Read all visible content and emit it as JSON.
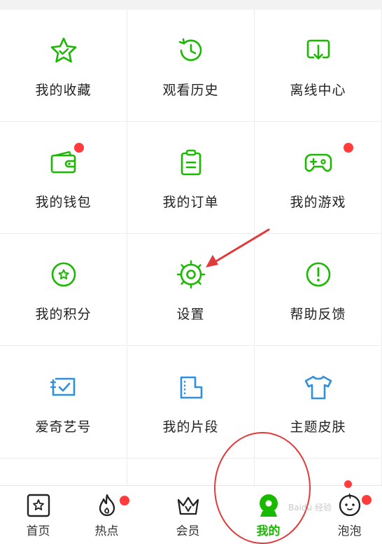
{
  "menu": {
    "items": [
      {
        "label": "我的收藏",
        "icon": "star-icon"
      },
      {
        "label": "观看历史",
        "icon": "history-clock-icon"
      },
      {
        "label": "离线中心",
        "icon": "download-icon"
      },
      {
        "label": "我的钱包",
        "icon": "wallet-icon",
        "badge": true
      },
      {
        "label": "我的订单",
        "icon": "clipboard-icon"
      },
      {
        "label": "我的游戏",
        "icon": "gamepad-icon",
        "badge": true
      },
      {
        "label": "我的积分",
        "icon": "points-star-icon"
      },
      {
        "label": "设置",
        "icon": "gear-icon"
      },
      {
        "label": "帮助反馈",
        "icon": "exclamation-icon"
      },
      {
        "label": "爱奇艺号",
        "icon": "iqiyi-account-icon"
      },
      {
        "label": "我的片段",
        "icon": "clip-icon"
      },
      {
        "label": "主题皮肤",
        "icon": "tshirt-icon"
      }
    ]
  },
  "tabbar": {
    "tabs": [
      {
        "label": "首页",
        "icon": "home-icon"
      },
      {
        "label": "热点",
        "icon": "flame-icon",
        "badge": true
      },
      {
        "label": "会员",
        "icon": "crown-icon"
      },
      {
        "label": "我的",
        "icon": "profile-icon",
        "active": true
      },
      {
        "label": "泡泡",
        "icon": "bubble-face-icon",
        "badge": true
      }
    ]
  },
  "annotations": {
    "watermark": "Baidu 经验"
  },
  "colors": {
    "green": "#19b900",
    "blue": "#2f8fe0",
    "badge": "#ff3b3b",
    "annotation": "#e23a3a"
  }
}
